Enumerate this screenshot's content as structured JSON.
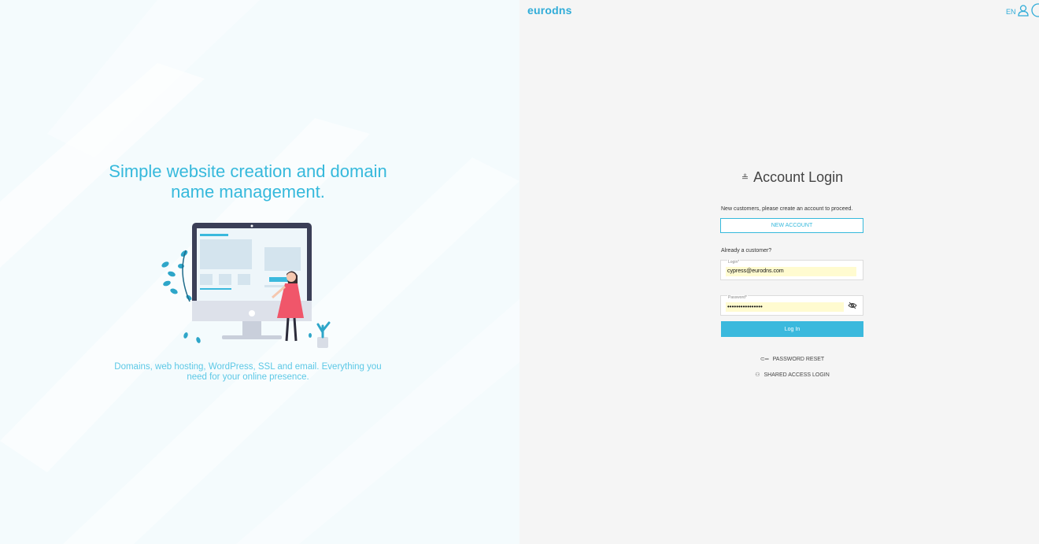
{
  "brand": {
    "logo_text": "eurodns",
    "accent": "#36b9dc"
  },
  "header": {
    "language": "EN",
    "icons": [
      "user-icon",
      "circle-icon"
    ]
  },
  "hero": {
    "headline": "Simple website creation and domain name management.",
    "tagline": "Domains, web hosting, WordPress, SSL and email. Everything you need for your online presence."
  },
  "login": {
    "title": "Account Login",
    "new_customers_text": "New customers, please create an account to proceed.",
    "new_account_button": "NEW ACCOUNT",
    "already_customer_text": "Already a customer?",
    "login_label": "Login*",
    "login_value": "cypress@eurodns.com",
    "password_label": "Password*",
    "password_value": "••••••••••••••••",
    "submit_button": "Log In",
    "password_reset": "PASSWORD RESET",
    "shared_access": "SHARED ACCESS LOGIN"
  }
}
